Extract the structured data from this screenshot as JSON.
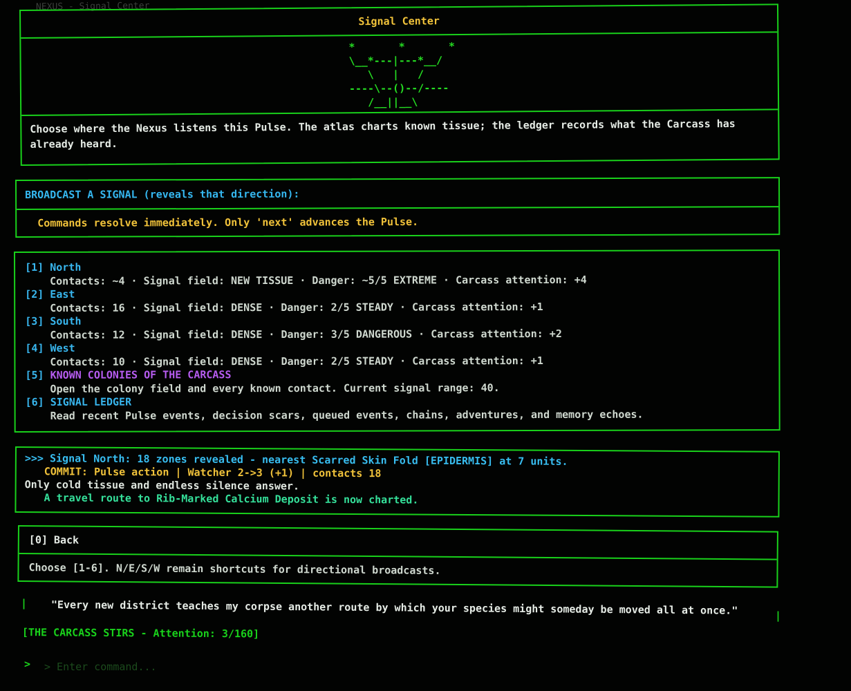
{
  "breadcrumb": "NEXUS - Signal Center",
  "header": {
    "title": "Signal Center",
    "art": "*       *       *\n\\__*---|---*__/\n   \\   |   /\n----\\--()--/----\n   /__||__\\",
    "intro": "Choose where the Nexus listens this Pulse. The atlas charts known tissue; the ledger records what the Carcass has already heard."
  },
  "broadcast": {
    "heading": "BROADCAST A SIGNAL (reveals that direction):",
    "note": "Commands resolve immediately. Only 'next' advances the Pulse."
  },
  "options": [
    {
      "num": "[1]",
      "label": "North",
      "detail": "Contacts: ~4 · Signal field: NEW TISSUE · Danger: ~5/5 EXTREME · Carcass attention: +4"
    },
    {
      "num": "[2]",
      "label": "East",
      "detail": "Contacts: 16 · Signal field: DENSE · Danger: 2/5 STEADY · Carcass attention: +1"
    },
    {
      "num": "[3]",
      "label": "South",
      "detail": "Contacts: 12 · Signal field: DENSE · Danger: 3/5 DANGEROUS · Carcass attention: +2"
    },
    {
      "num": "[4]",
      "label": "West",
      "detail": "Contacts: 10 · Signal field: DENSE · Danger: 2/5 STEADY · Carcass attention: +1"
    },
    {
      "num": "[5]",
      "label": "KNOWN COLONIES OF THE CARCASS",
      "detail": "Open the colony field and every known contact. Current signal range: 40."
    },
    {
      "num": "[6]",
      "label": "SIGNAL LEDGER",
      "detail": "Read recent Pulse events, decision scars, queued events, chains, adventures, and memory echoes."
    }
  ],
  "log": {
    "line1": ">>> Signal North: 18 zones revealed - nearest Scarred Skin Fold [EPIDERMIS] at 7 units.",
    "line2": "COMMIT: Pulse action | Watcher 2->3 (+1) | contacts 18",
    "line3": "Only cold tissue and endless silence answer.",
    "line4": "A travel route to Rib-Marked Calcium Deposit is now charted."
  },
  "nav": {
    "back_label": "[0] Back",
    "choose_hint": "Choose [1-6]. N/E/S/W remain shortcuts for directional broadcasts."
  },
  "quote": "\"Every new district teaches my corpse another route by which your species might someday be moved all at once.\"",
  "status": "[THE CARCASS STIRS - Attention: 3/160]",
  "prompt": {
    "arrow": ">",
    "placeholder": "> Enter command..."
  },
  "colors": {
    "border": "#19d11b",
    "accent_cyan": "#38b6ee",
    "accent_yellow": "#f0c23a",
    "accent_purple": "#b65cf0",
    "accent_green": "#35e09a"
  }
}
